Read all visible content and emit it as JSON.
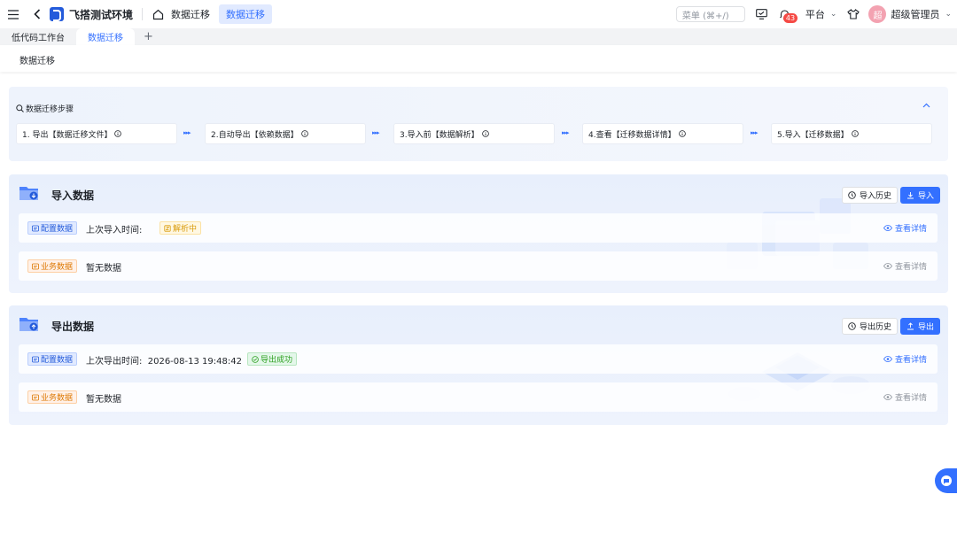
{
  "app": {
    "title": "飞搭测试环境"
  },
  "breadcrumb": {
    "item": "数据迁移",
    "active": "数据迁移"
  },
  "topbar": {
    "search_placeholder": "菜单 (⌘+/)",
    "notification_count": "43",
    "platform": "平台",
    "username": "超级管理员",
    "avatar_text": "超"
  },
  "tabs": [
    {
      "label": "低代码工作台"
    },
    {
      "label": "数据迁移"
    }
  ],
  "tab_add": "+",
  "page": {
    "title": "数据迁移"
  },
  "steps": {
    "title": "数据迁移步骤",
    "items": [
      {
        "label": "1. 导出【数据迁移文件】"
      },
      {
        "label": "2.自动导出【依赖数据】"
      },
      {
        "label": "3.导入前【数据解析】"
      },
      {
        "label": "4.查看【迁移数据详情】"
      },
      {
        "label": "5.导入【迁移数据】"
      }
    ]
  },
  "import_section": {
    "title": "导入数据",
    "history_button": "导入历史",
    "primary_button": "导入",
    "rows": [
      {
        "tag": "配置数据",
        "label": "上次导入时间:",
        "status": "解析中",
        "detail": "查看详情"
      },
      {
        "tag": "业务数据",
        "label": "暂无数据",
        "detail": "查看详情"
      }
    ]
  },
  "export_section": {
    "title": "导出数据",
    "history_button": "导出历史",
    "primary_button": "导出",
    "rows": [
      {
        "tag": "配置数据",
        "label": "上次导出时间:  2026-08-13 19:48:42",
        "status": "导出成功",
        "detail": "查看详情"
      },
      {
        "tag": "业务数据",
        "label": "暂无数据",
        "detail": "查看详情"
      }
    ]
  },
  "colors": {
    "primary": "#3370ff",
    "danger": "#f54a45",
    "warning": "#d99b0b",
    "success": "#2ea121",
    "business_tag": "#de7802"
  }
}
